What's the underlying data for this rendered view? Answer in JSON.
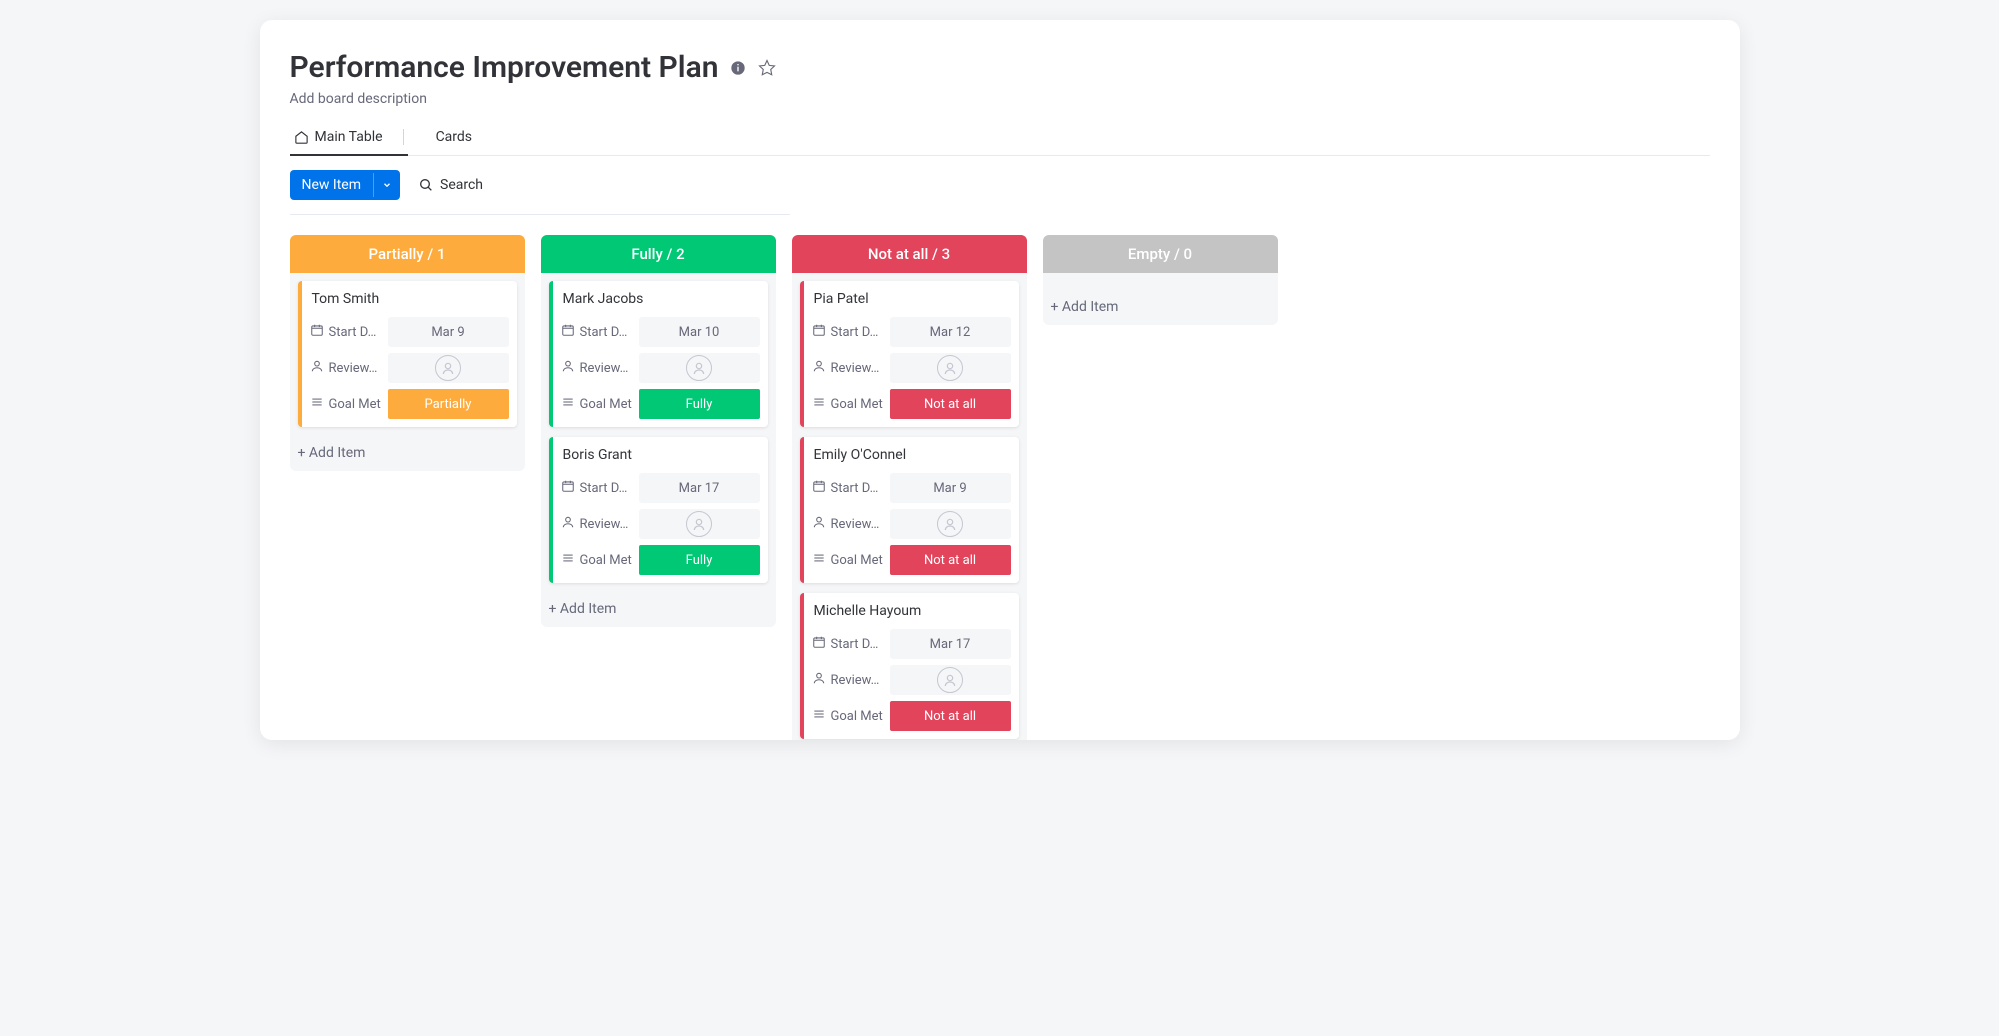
{
  "header": {
    "title": "Performance Improvement Plan",
    "description_placeholder": "Add board description"
  },
  "tabs": {
    "main_table": "Main Table",
    "cards": "Cards"
  },
  "controls": {
    "new_item": "New Item",
    "search": "Search"
  },
  "field_labels": {
    "start_date": "Start D…",
    "reviewer": "Review…",
    "goal_met": "Goal Met"
  },
  "add_item": "+ Add Item",
  "columns": [
    {
      "id": "partially",
      "title": "Partially / 1",
      "color_class": "col-partially",
      "status_class": "status-partially",
      "status_label": "Partially",
      "cards": [
        {
          "name": "Tom Smith",
          "start_date": "Mar 9"
        }
      ]
    },
    {
      "id": "fully",
      "title": "Fully / 2",
      "color_class": "col-fully",
      "status_class": "status-fully",
      "status_label": "Fully",
      "cards": [
        {
          "name": "Mark Jacobs",
          "start_date": "Mar 10"
        },
        {
          "name": "Boris Grant",
          "start_date": "Mar 17"
        }
      ]
    },
    {
      "id": "notatall",
      "title": "Not at all / 3",
      "color_class": "col-notatall",
      "status_class": "status-notatall",
      "status_label": "Not at all",
      "cards": [
        {
          "name": "Pia Patel",
          "start_date": "Mar 12"
        },
        {
          "name": "Emily O'Connel",
          "start_date": "Mar 9"
        },
        {
          "name": "Michelle Hayoum",
          "start_date": "Mar 17"
        }
      ]
    },
    {
      "id": "empty",
      "title": "Empty / 0",
      "color_class": "col-empty",
      "status_class": "",
      "status_label": "",
      "cards": []
    }
  ]
}
